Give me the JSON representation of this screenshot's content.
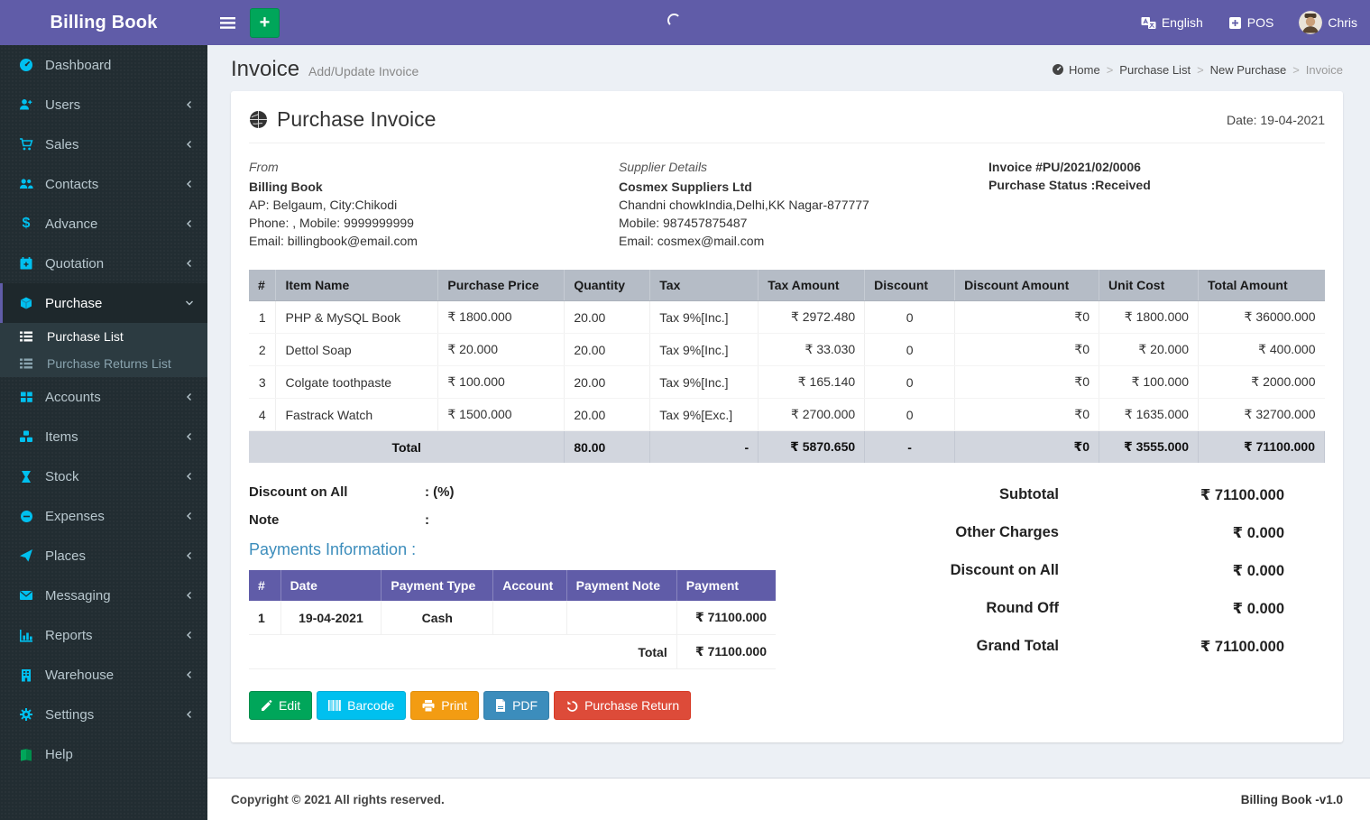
{
  "app": {
    "title": "Billing Book",
    "copyright": "Copyright © 2021 All rights reserved.",
    "version_label": "Billing Book -v1.0"
  },
  "navbar": {
    "language_label": "English",
    "pos_label": "POS",
    "user_name": "Chris"
  },
  "sidebar": {
    "items": [
      {
        "label": "Dashboard"
      },
      {
        "label": "Users"
      },
      {
        "label": "Sales"
      },
      {
        "label": "Contacts"
      },
      {
        "label": "Advance"
      },
      {
        "label": "Quotation"
      },
      {
        "label": "Purchase"
      },
      {
        "label": "Accounts"
      },
      {
        "label": "Items"
      },
      {
        "label": "Stock"
      },
      {
        "label": "Expenses"
      },
      {
        "label": "Places"
      },
      {
        "label": "Messaging"
      },
      {
        "label": "Reports"
      },
      {
        "label": "Warehouse"
      },
      {
        "label": "Settings"
      },
      {
        "label": "Help"
      }
    ],
    "purchase_submenu": [
      "Purchase List",
      "Purchase Returns List"
    ]
  },
  "page": {
    "title": "Invoice",
    "subtitle": "Add/Update Invoice",
    "breadcrumb": [
      "Home",
      "Purchase List",
      "New Purchase",
      "Invoice"
    ]
  },
  "invoice": {
    "heading": "Purchase Invoice",
    "date_label": "Date: 19-04-2021",
    "from": {
      "section_label": "From",
      "name": "Billing Book",
      "address": "AP: Belgaum, City:Chikodi",
      "phone": "Phone: , Mobile: 9999999999",
      "email": "Email: billingbook@email.com"
    },
    "supplier": {
      "section_label": "Supplier Details",
      "name": "Cosmex Suppliers Ltd",
      "address": "Chandni chowkIndia,Delhi,KK Nagar-877777",
      "mobile": "Mobile: 987457875487",
      "email": "Email: cosmex@mail.com"
    },
    "meta": {
      "invoice_no": "Invoice #PU/2021/02/0006",
      "status": "Purchase Status :Received"
    },
    "items_table": {
      "headers": [
        "#",
        "Item Name",
        "Purchase Price",
        "Quantity",
        "Tax",
        "Tax Amount",
        "Discount",
        "Discount Amount",
        "Unit Cost",
        "Total Amount"
      ],
      "rows": [
        {
          "no": "1",
          "item_name": "PHP & MySQL Book",
          "purchase_price": "₹ 1800.000",
          "quantity": "20.00",
          "tax": "Tax 9%[Inc.]",
          "tax_amount": "₹ 2972.480",
          "discount": "0",
          "discount_amount": "₹0",
          "unit_cost": "₹ 1800.000",
          "total_amount": "₹ 36000.000"
        },
        {
          "no": "2",
          "item_name": "Dettol Soap",
          "purchase_price": "₹ 20.000",
          "quantity": "20.00",
          "tax": "Tax 9%[Inc.]",
          "tax_amount": "₹ 33.030",
          "discount": "0",
          "discount_amount": "₹0",
          "unit_cost": "₹ 20.000",
          "total_amount": "₹ 400.000"
        },
        {
          "no": "3",
          "item_name": "Colgate toothpaste",
          "purchase_price": "₹ 100.000",
          "quantity": "20.00",
          "tax": "Tax 9%[Inc.]",
          "tax_amount": "₹ 165.140",
          "discount": "0",
          "discount_amount": "₹0",
          "unit_cost": "₹ 100.000",
          "total_amount": "₹ 2000.000"
        },
        {
          "no": "4",
          "item_name": "Fastrack Watch",
          "purchase_price": "₹ 1500.000",
          "quantity": "20.00",
          "tax": "Tax 9%[Exc.]",
          "tax_amount": "₹ 2700.000",
          "discount": "0",
          "discount_amount": "₹0",
          "unit_cost": "₹ 1635.000",
          "total_amount": "₹ 32700.000"
        }
      ],
      "total": {
        "label": "Total",
        "quantity": "80.00",
        "tax": "-",
        "tax_amount": "₹ 5870.650",
        "discount": "-",
        "discount_amount": "₹0",
        "unit_cost": "₹ 3555.000",
        "total_amount": "₹ 71100.000"
      }
    },
    "discount_on_all": {
      "label": "Discount on All",
      "value": ": (%)"
    },
    "note": {
      "label": "Note",
      "value": ":"
    },
    "payments": {
      "heading": "Payments Information :",
      "headers": [
        "#",
        "Date",
        "Payment Type",
        "Account",
        "Payment Note",
        "Payment"
      ],
      "rows": [
        {
          "no": "1",
          "date": "19-04-2021",
          "type": "Cash",
          "account": "",
          "note": "",
          "amount": "₹ 71100.000"
        }
      ],
      "total_label": "Total",
      "total_amount": "₹ 71100.000"
    },
    "summary": [
      {
        "label": "Subtotal",
        "value": "₹ 71100.000"
      },
      {
        "label": "Other Charges",
        "value": "₹ 0.000"
      },
      {
        "label": "Discount on All",
        "value": "₹ 0.000"
      },
      {
        "label": "Round Off",
        "value": "₹ 0.000"
      },
      {
        "label": "Grand Total",
        "value": "₹ 71100.000"
      }
    ],
    "actions": [
      {
        "label": "Edit"
      },
      {
        "label": "Barcode"
      },
      {
        "label": "Print"
      },
      {
        "label": "PDF"
      },
      {
        "label": "Purchase Return"
      }
    ]
  },
  "icons": {
    "hamburger": "three-bars",
    "plus": "+",
    "language": "translate-card",
    "pos": "plus-square",
    "spinner": "loading-arc",
    "globe": "filled-globe",
    "home": "gauge",
    "rupee": "₹"
  },
  "colors": {
    "navbar": "#605ca8",
    "sidebar_bg": "#222d32",
    "sidebar_active_bg": "#1e282c",
    "submenu_bg": "#2c3b41",
    "icon_accent": "#00c0ef",
    "page_bg": "#ecf0f5",
    "table_header_bg": "#b5bcc6",
    "table_total_bg": "#d2d6de",
    "payments_header_bg": "#605ca8",
    "heading_link": "#3c8dbc",
    "btn_edit": "#00a65a",
    "btn_barcode": "#00c0ef",
    "btn_print": "#f39c12",
    "btn_pdf": "#3c8dbc",
    "btn_return": "#dd4b39",
    "help_icon": "#00a65a"
  }
}
